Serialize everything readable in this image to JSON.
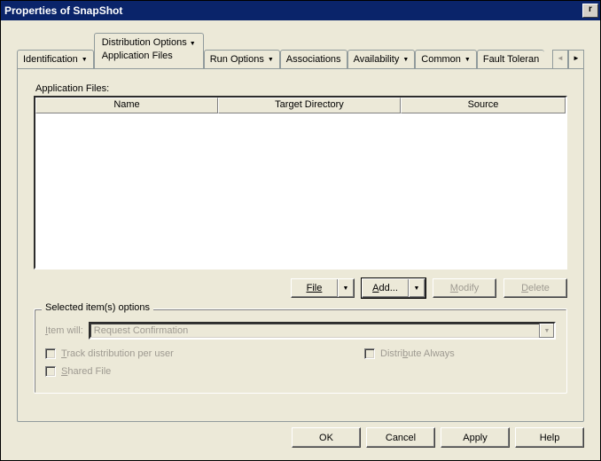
{
  "window": {
    "title": "Properties of SnapShot"
  },
  "tabs": {
    "identification": "Identification",
    "distribution_line1": "Distribution Options",
    "distribution_line2": "Application Files",
    "run": "Run Options",
    "associations": "Associations",
    "availability": "Availability",
    "common": "Common",
    "fault": "Fault Toleran"
  },
  "appfiles": {
    "label": "Application Files:",
    "cols": {
      "name": "Name",
      "target": "Target Directory",
      "source": "Source"
    },
    "rows": []
  },
  "buttons": {
    "file": "File",
    "add": "Add...",
    "modify": "Modify",
    "delete": "Delete"
  },
  "group": {
    "legend": "Selected item(s) options",
    "item_will": "Item will:",
    "combo_value": "Request Confirmation",
    "track": "Track distribution per user",
    "dist_always": "Distribute Always",
    "shared": "Shared File"
  },
  "dialog": {
    "ok": "OK",
    "cancel": "Cancel",
    "apply": "Apply",
    "help": "Help"
  }
}
